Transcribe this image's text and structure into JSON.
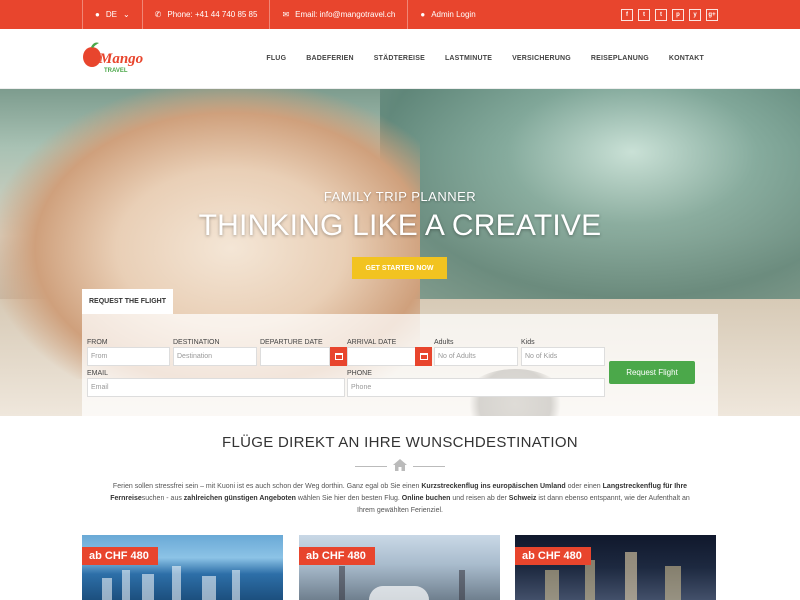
{
  "topbar": {
    "language": "DE",
    "phone": "Phone: +41 44 740 85 85",
    "email": "Email: info@mangotravel.ch",
    "admin": "Admin Login",
    "socials": [
      "f",
      "t",
      "t",
      "p",
      "y",
      "g+"
    ]
  },
  "logo": {
    "main": "Mango",
    "sub": "TRAVEL"
  },
  "nav": [
    "FLUG",
    "BADEFERIEN",
    "STÄDTEREISE",
    "LASTMINUTE",
    "VERSICHERUNG",
    "REISEPLANUNG",
    "KONTAKT"
  ],
  "hero": {
    "subtitle": "FAMILY TRIP PLANNER",
    "title": "THINKING LIKE A CREATIVE",
    "cta": "GET STARTED NOW"
  },
  "booking": {
    "tab": "REQUEST THE FLIGHT",
    "from_label": "FROM",
    "from_placeholder": "From",
    "destination_label": "DESTINATION",
    "destination_placeholder": "Destination",
    "departure_label": "DEPARTURE DATE",
    "arrival_label": "ARRIVAL DATE",
    "adults_label": "Adults",
    "adults_placeholder": "No of Adults",
    "kids_label": "Kids",
    "kids_placeholder": "No of Kids",
    "email_label": "EMAIL",
    "email_placeholder": "Email",
    "phone_label": "PHONE",
    "phone_placeholder": "Phone",
    "submit": "Request Flight"
  },
  "section": {
    "title": "FLÜGE DIREKT AN IHRE WUNSCHDESTINATION",
    "p1": "Ferien sollen stressfrei sein – mit Kuoni ist es auch schon der Weg dorthin. Ganz egal ob Sie einen ",
    "b1": "Kurzstreckenflug ins europäischen Umland",
    "p2": " oder einen ",
    "b2": "Langstreckenflug für Ihre Fernreise",
    "p3": "suchen - aus ",
    "b3": "zahlreichen günstigen Angeboten",
    "p4": " wählen Sie hier den besten Flug. ",
    "b4": "Online buchen",
    "p5": " und reisen ab der ",
    "b5": "Schweiz",
    "p6": " ist dann ebenso entspannt, wie der Aufenthalt an Ihrem gewählten Ferienziel."
  },
  "cards": [
    {
      "price": "ab CHF 480"
    },
    {
      "price": "ab CHF 480"
    },
    {
      "price": "ab CHF 480"
    }
  ],
  "colors": {
    "accent": "#e8452d",
    "cta": "#f2c320",
    "button": "#4ba84a"
  }
}
